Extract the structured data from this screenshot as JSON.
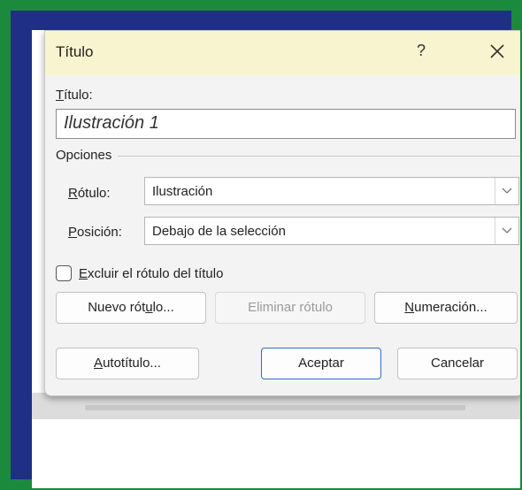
{
  "dialog": {
    "title": "Título",
    "help_icon": "?",
    "close_icon": "close-icon"
  },
  "caption": {
    "label_first": "T",
    "label_rest": "ítulo:",
    "value": "Ilustración 1"
  },
  "options": {
    "section_label": "Opciones",
    "label_field": {
      "label_first": "R",
      "label_rest": "ótulo:",
      "value": "Ilustración"
    },
    "position_field": {
      "label_first": "P",
      "label_rest": "osición:",
      "value": "Debajo de la selección"
    }
  },
  "exclude": {
    "label_first": "E",
    "label_rest": "xcluir el rótulo del título",
    "checked": false
  },
  "buttons": {
    "new_label_pre": "Nuevo rót",
    "new_label_u": "u",
    "new_label_post": "lo...",
    "delete_label": "Eliminar rótulo",
    "numbering_first": "N",
    "numbering_rest": "umeración...",
    "autocaption_first": "A",
    "autocaption_rest": "utotítulo...",
    "ok": "Aceptar",
    "cancel": "Cancelar"
  },
  "colors": {
    "outer_border": "#1b8a3c",
    "inner_frame": "#1f2f86",
    "titlebar": "#f8f4cf",
    "primary_border": "#2f6fc2"
  }
}
